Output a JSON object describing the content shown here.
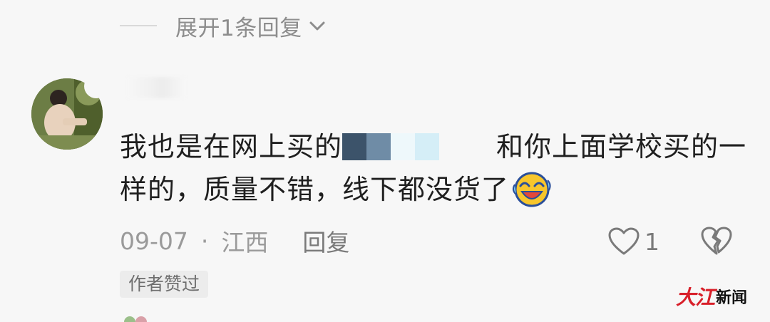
{
  "thread": {
    "expand_label": "展开1条回复"
  },
  "comment": {
    "text_before_blur": "我也是在网上买的",
    "text_after_blur": "和你上面学校买的一样的，质量不错，线下都没货了",
    "date": "09-07",
    "separator": "·",
    "location": "江西",
    "reply_label": "回复",
    "like_count": "1",
    "author_badge": "作者赞过"
  },
  "watermark": {
    "red_text": "大江",
    "black_text": "新闻"
  },
  "icons": {
    "expand": "chevron-down-icon",
    "like": "heart-icon",
    "dislike": "broken-heart-icon",
    "emoji": "laughing-crying-emoji"
  },
  "colors": {
    "background": "#f7f7f7",
    "text_primary": "#1f1f1f",
    "text_secondary": "#9a9a9a",
    "watermark_red": "#d8202a"
  }
}
